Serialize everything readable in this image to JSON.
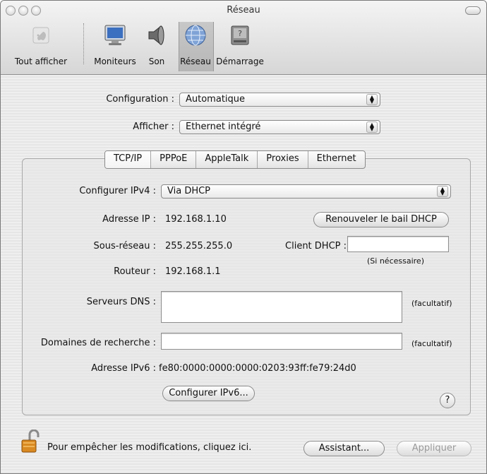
{
  "window": {
    "title": "Réseau"
  },
  "toolbar": {
    "show_all": "Tout afficher",
    "displays": "Moniteurs",
    "sound": "Son",
    "network": "Réseau",
    "startup": "Démarrage"
  },
  "config": {
    "configuration_label": "Configuration :",
    "configuration_value": "Automatique",
    "show_label": "Afficher :",
    "show_value": "Ethernet intégré"
  },
  "tabs": [
    "TCP/IP",
    "PPPoE",
    "AppleTalk",
    "Proxies",
    "Ethernet"
  ],
  "tcpip": {
    "configure_ipv4_label": "Configurer IPv4 :",
    "configure_ipv4_value": "Via DHCP",
    "ip_label": "Adresse IP :",
    "ip_value": "192.168.1.10",
    "renew_button": "Renouveler le bail DHCP",
    "subnet_label": "Sous-réseau :",
    "subnet_value": "255.255.255.0",
    "dhcp_client_label": "Client DHCP :",
    "dhcp_client_value": "",
    "if_needed": "(Si nécessaire)",
    "router_label": "Routeur :",
    "router_value": "192.168.1.1",
    "dns_label": "Serveurs DNS :",
    "dns_value": "",
    "optional1": "(facultatif)",
    "search_domains_label": "Domaines de recherche :",
    "search_domains_value": "",
    "optional2": "(facultatif)",
    "ipv6_label": "Adresse IPv6 :",
    "ipv6_value": "fe80:0000:0000:0000:0203:93ff:fe79:24d0",
    "configure_ipv6_button": "Configurer IPv6...",
    "help": "?"
  },
  "footer": {
    "lock_text": "Pour empêcher les modifications, cliquez ici.",
    "assistant_button": "Assistant...",
    "apply_button": "Appliquer"
  }
}
